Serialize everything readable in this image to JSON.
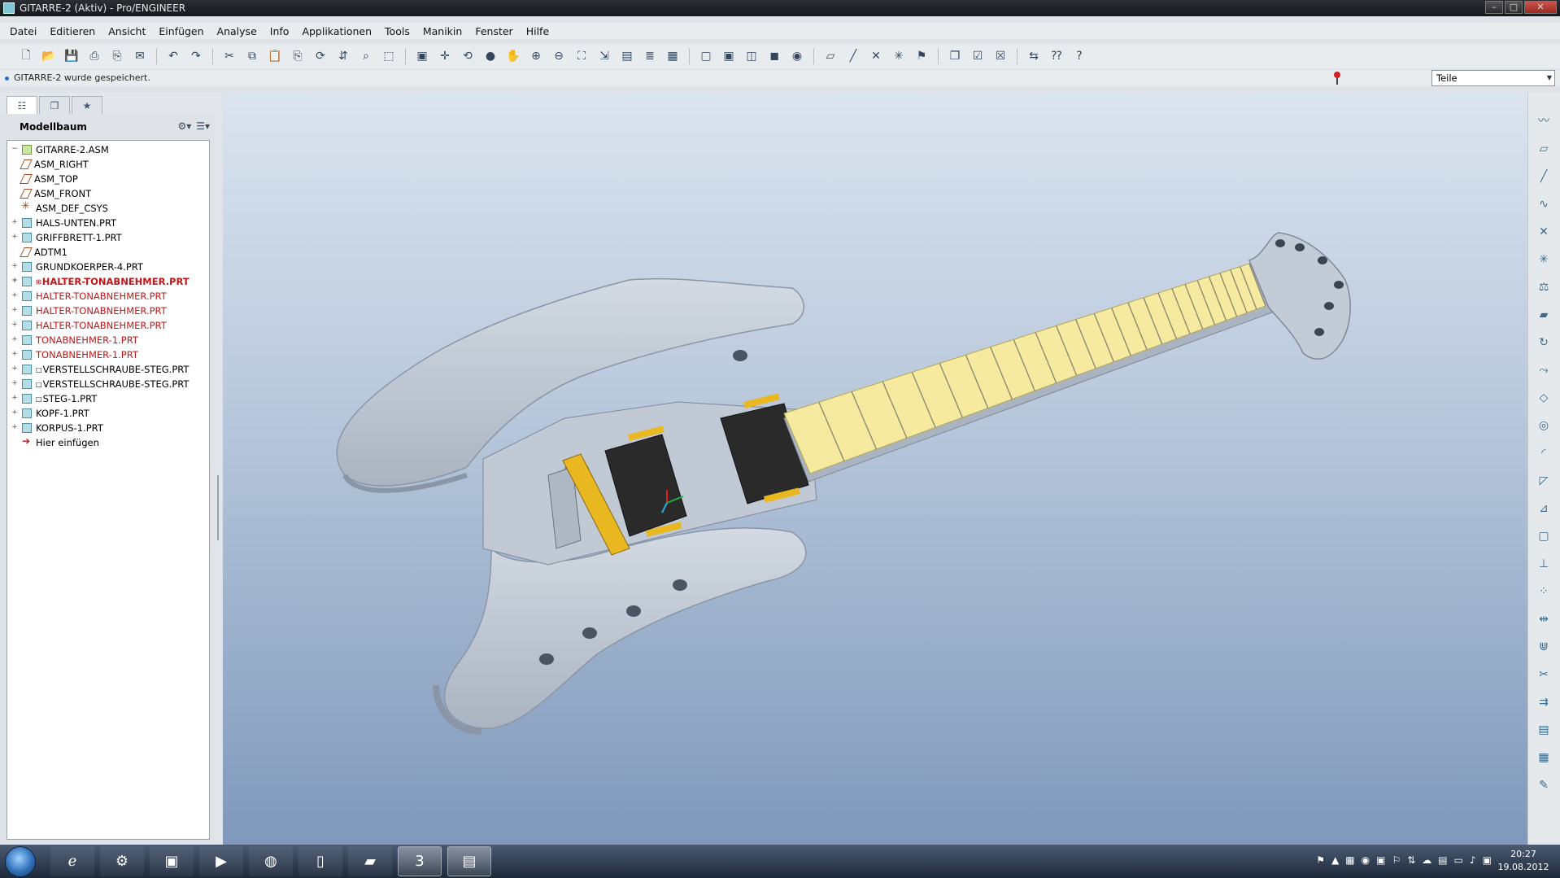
{
  "window": {
    "title": "GITARRE-2 (Aktiv) - Pro/ENGINEER",
    "controls": [
      "minimize-icon",
      "maximize-icon",
      "close-icon"
    ]
  },
  "menu": [
    "Datei",
    "Editieren",
    "Ansicht",
    "Einfügen",
    "Analyse",
    "Info",
    "Applikationen",
    "Tools",
    "Manikin",
    "Fenster",
    "Hilfe"
  ],
  "toolbar": {
    "groups": [
      [
        "new-icon",
        "open-icon",
        "save-icon",
        "print-icon",
        "print-preview-icon",
        "email-icon"
      ],
      [
        "undo-icon",
        "redo-icon"
      ],
      [
        "cut-icon",
        "copy-icon",
        "paste-icon",
        "paste-special-icon",
        "regenerate-icon",
        "regen-manager-icon",
        "find-icon",
        "select-box-icon"
      ],
      [
        "repaint-icon",
        "spin-center-icon",
        "orient-icon",
        "display-style-icon",
        "pan-icon",
        "zoom-in-icon",
        "zoom-out-icon",
        "refit-icon",
        "reorient-icon",
        "saved-views-icon",
        "layers-icon",
        "view-manager-icon"
      ],
      [
        "wireframe-icon",
        "hidden-line-icon",
        "no-hidden-icon",
        "shading-icon",
        "enhanced-realism-icon"
      ],
      [
        "datum-planes-icon",
        "datum-axes-icon",
        "datum-points-icon",
        "csys-icon",
        "annotations-icon"
      ],
      [
        "window-icon",
        "activate-icon",
        "close-window-icon"
      ],
      [
        "flip-icon",
        "context-help-icon",
        "whats-this-icon"
      ]
    ]
  },
  "message": {
    "text": "GITARRE-2 wurde gespeichert."
  },
  "filter": {
    "selected": "Teile"
  },
  "navigator": {
    "tabs": [
      "model-tree-icon",
      "folder-browser-icon",
      "favorites-icon"
    ],
    "header": "Modellbaum",
    "header_tools": [
      "settings-icon",
      "show-icon"
    ],
    "items": [
      {
        "label": "GITARRE-2.ASM",
        "icon": "asm",
        "expander": "−",
        "status": "normal"
      },
      {
        "label": "ASM_RIGHT",
        "icon": "plane",
        "expander": "",
        "status": "normal"
      },
      {
        "label": "ASM_TOP",
        "icon": "plane",
        "expander": "",
        "status": "normal"
      },
      {
        "label": "ASM_FRONT",
        "icon": "plane",
        "expander": "",
        "status": "normal"
      },
      {
        "label": "ASM_DEF_CSYS",
        "icon": "csys",
        "expander": "",
        "status": "normal"
      },
      {
        "label": "HALS-UNTEN.PRT",
        "icon": "prt",
        "expander": "+",
        "status": "normal"
      },
      {
        "label": "GRIFFBRETT-1.PRT",
        "icon": "prt",
        "expander": "+",
        "status": "normal"
      },
      {
        "label": "ADTM1",
        "icon": "plane",
        "expander": "",
        "status": "normal"
      },
      {
        "label": "GRUNDKOERPER-4.PRT",
        "icon": "prt",
        "expander": "+",
        "status": "normal"
      },
      {
        "label": "HALTER-TONABNEHMER.PRT",
        "icon": "prt",
        "expander": "+",
        "status": "selected",
        "prefix": "⊞"
      },
      {
        "label": "HALTER-TONABNEHMER.PRT",
        "icon": "prt",
        "expander": "+",
        "status": "red"
      },
      {
        "label": "HALTER-TONABNEHMER.PRT",
        "icon": "prt",
        "expander": "+",
        "status": "red"
      },
      {
        "label": "HALTER-TONABNEHMER.PRT",
        "icon": "prt",
        "expander": "+",
        "status": "red"
      },
      {
        "label": "TONABNEHMER-1.PRT",
        "icon": "prt",
        "expander": "+",
        "status": "red"
      },
      {
        "label": "TONABNEHMER-1.PRT",
        "icon": "prt",
        "expander": "+",
        "status": "red"
      },
      {
        "label": "VERSTELLSCHRAUBE-STEG.PRT",
        "icon": "prt",
        "expander": "+",
        "status": "normal",
        "prefix": "□"
      },
      {
        "label": "VERSTELLSCHRAUBE-STEG.PRT",
        "icon": "prt",
        "expander": "+",
        "status": "normal",
        "prefix": "□"
      },
      {
        "label": "STEG-1.PRT",
        "icon": "prt",
        "expander": "+",
        "status": "normal",
        "prefix": "□"
      },
      {
        "label": "KOPF-1.PRT",
        "icon": "prt",
        "expander": "+",
        "status": "normal"
      },
      {
        "label": "KORPUS-1.PRT",
        "icon": "prt",
        "expander": "+",
        "status": "normal"
      },
      {
        "label": "Hier einfügen",
        "icon": "ins",
        "expander": "",
        "status": "normal"
      }
    ]
  },
  "colors": {
    "red_item": "#c01818",
    "body": "#c8d0da",
    "fretboard": "#f5eaa0",
    "pickup": "#2a2a2a",
    "gold": "#e9b820"
  },
  "right_toolbar": [
    "sketch-icon",
    "plane-icon",
    "axis-icon",
    "curve-icon",
    "point-icon",
    "csys-icon",
    "analysis-icon",
    "extrude-icon",
    "revolve-icon",
    "sweep-icon",
    "blend-icon",
    "hole-icon",
    "round-icon",
    "chamfer-icon",
    "draft-icon",
    "shell-icon",
    "rib-icon",
    "pattern-icon",
    "mirror-icon",
    "merge-icon",
    "trim-icon",
    "offset-icon",
    "thicken-icon",
    "solidify-icon",
    "style-icon"
  ],
  "taskbar": {
    "apps": [
      "ie-icon",
      "proe-icon",
      "explorer-window-icon",
      "media-player-icon",
      "firefox-icon",
      "document-icon",
      "folder-icon",
      "app3-icon",
      "proe-active-icon"
    ],
    "tray": [
      "tray-1-icon",
      "tray-2-icon",
      "tray-3-icon",
      "tray-4-icon",
      "tray-5-icon",
      "tray-6-icon",
      "tray-7-icon",
      "tray-8-icon",
      "tray-9-icon",
      "tray-10-icon",
      "volume-icon",
      "tray-12-icon"
    ],
    "time": "20:27",
    "date": "19.08.2012"
  }
}
